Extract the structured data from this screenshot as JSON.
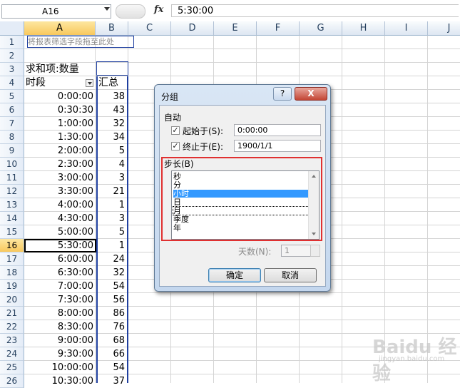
{
  "formula_bar": {
    "name_box": "A16",
    "fx_label": "fx",
    "formula": "5:30:00"
  },
  "columns": [
    "A",
    "B",
    "C",
    "D",
    "E",
    "F",
    "G",
    "H",
    "I",
    "J"
  ],
  "rows": [
    "1",
    "2",
    "3",
    "4",
    "5",
    "6",
    "7",
    "8",
    "9",
    "10",
    "11",
    "12",
    "13",
    "14",
    "15",
    "16",
    "17",
    "18",
    "19",
    "20",
    "21",
    "22",
    "23",
    "24",
    "25",
    "26"
  ],
  "pivot": {
    "drop_hint": "将报表筛选字段拖至此处",
    "sum_label": "求和项:数量",
    "header_time": "时段",
    "header_total": "汇总",
    "data": [
      [
        "0:00:00",
        "38"
      ],
      [
        "0:30:30",
        "43"
      ],
      [
        "1:00:00",
        "32"
      ],
      [
        "1:30:00",
        "34"
      ],
      [
        "2:00:00",
        "5"
      ],
      [
        "2:30:00",
        "4"
      ],
      [
        "3:00:00",
        "3"
      ],
      [
        "3:30:00",
        "21"
      ],
      [
        "4:00:00",
        "1"
      ],
      [
        "4:30:00",
        "3"
      ],
      [
        "5:00:00",
        "5"
      ],
      [
        "5:30:00",
        "1"
      ],
      [
        "6:00:00",
        "24"
      ],
      [
        "6:30:00",
        "32"
      ],
      [
        "7:00:00",
        "54"
      ],
      [
        "7:30:00",
        "56"
      ],
      [
        "8:00:00",
        "86"
      ],
      [
        "8:30:00",
        "76"
      ],
      [
        "9:00:00",
        "68"
      ],
      [
        "9:30:00",
        "66"
      ],
      [
        "10:00:00",
        "54"
      ],
      [
        "10:30:00",
        "37"
      ]
    ]
  },
  "dialog": {
    "title": "分组",
    "help": "?",
    "close": "X",
    "auto_label": "自动",
    "start_label": "起始于(S):",
    "start_value": "0:00:00",
    "end_label": "终止于(E):",
    "end_value": "1900/1/1",
    "step_label": "步长(B)",
    "step_items": [
      "秒",
      "分",
      "小时",
      "日",
      "月",
      "季度",
      "年"
    ],
    "selected_item": "小时",
    "days_label": "天数(N):",
    "days_value": "1",
    "ok": "确定",
    "cancel": "取消"
  },
  "watermark": {
    "brand": "Baidu 经验",
    "url": "jingyan.baidu.com"
  },
  "colors": {
    "selection_blue": "#3399ff",
    "highlight_red": "#e03030",
    "pivot_border": "#1f3f9f"
  }
}
